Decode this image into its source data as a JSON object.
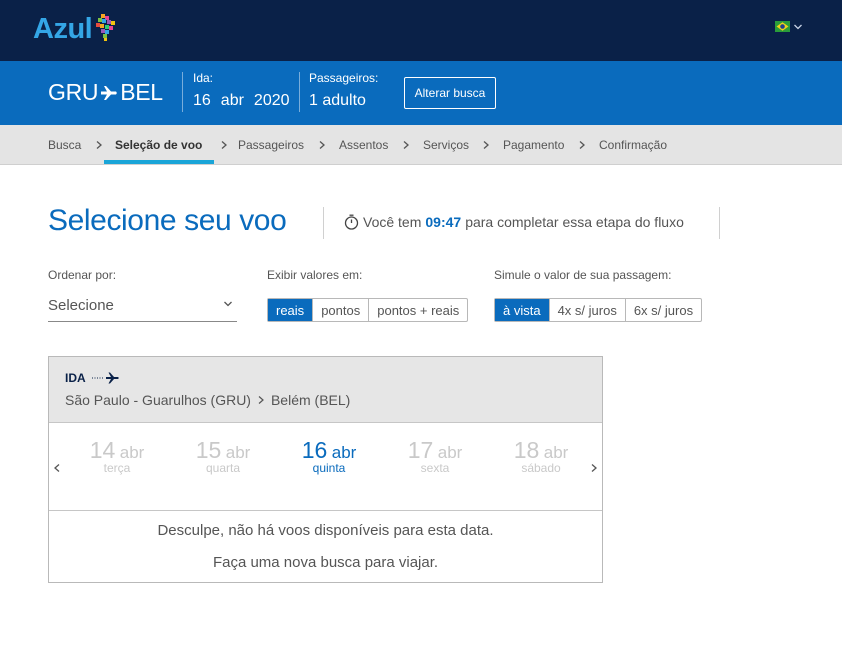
{
  "header": {
    "logo_text": "Azul",
    "language_flag": "brazil-flag-icon",
    "colors": {
      "navy": "#0a2148",
      "brand_blue": "#0a6bbd",
      "logo_blue": "#34a6e6",
      "accent_cyan": "#1aa5d8"
    }
  },
  "summary": {
    "origin": "GRU",
    "destination": "BEL",
    "ida_label": "Ida:",
    "ida_day": "16",
    "ida_month": "abr",
    "ida_year": "2020",
    "passengers_label": "Passageiros:",
    "passengers_value": "1 adulto",
    "alter_button": "Alterar busca"
  },
  "steps": [
    {
      "label": "Busca",
      "active": false
    },
    {
      "label": "Seleção de voo",
      "active": true
    },
    {
      "label": "Passageiros",
      "active": false
    },
    {
      "label": "Assentos",
      "active": false
    },
    {
      "label": "Serviços",
      "active": false
    },
    {
      "label": "Pagamento",
      "active": false
    },
    {
      "label": "Confirmação",
      "active": false
    }
  ],
  "main": {
    "title": "Selecione seu voo",
    "timer_prefix": "Você tem",
    "timer_value": "09:47",
    "timer_suffix": "para completar essa etapa do fluxo"
  },
  "filters": {
    "sort_label": "Ordenar por:",
    "sort_value": "Selecione",
    "display_label": "Exibir valores em:",
    "display_options": [
      "reais",
      "pontos",
      "pontos + reais"
    ],
    "display_selected": "reais",
    "simulate_label": "Simule o valor de sua passagem:",
    "simulate_options": [
      "à vista",
      "4x s/ juros",
      "6x s/ juros"
    ],
    "simulate_selected": "à vista"
  },
  "flight_card": {
    "direction": "IDA",
    "origin_city": "São Paulo - Guarulhos (GRU)",
    "destination_city": "Belém (BEL)",
    "dates": [
      {
        "day": "14",
        "month": "abr",
        "weekday": "terça",
        "selected": false
      },
      {
        "day": "15",
        "month": "abr",
        "weekday": "quarta",
        "selected": false
      },
      {
        "day": "16",
        "month": "abr",
        "weekday": "quinta",
        "selected": true
      },
      {
        "day": "17",
        "month": "abr",
        "weekday": "sexta",
        "selected": false
      },
      {
        "day": "18",
        "month": "abr",
        "weekday": "sábado",
        "selected": false
      }
    ],
    "no_flights_message": "Desculpe, não há voos disponíveis para esta data.",
    "new_search_message": "Faça uma nova busca para viajar."
  }
}
